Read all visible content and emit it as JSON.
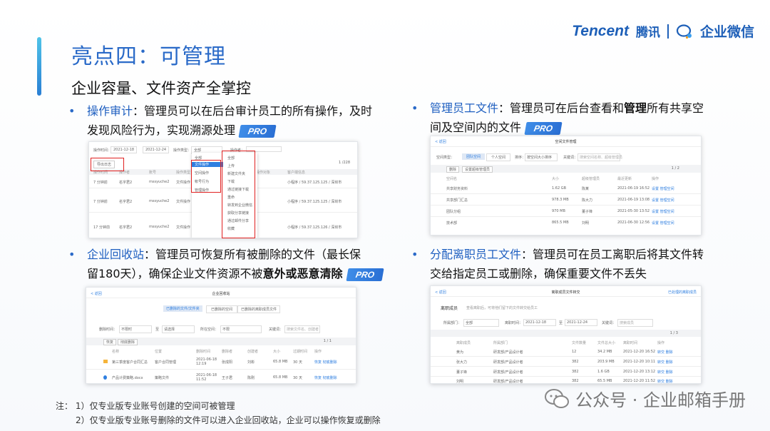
{
  "header": {
    "title": "亮点四：可管理",
    "subtitle": "企业容量、文件资产全掌控",
    "brand_tencent": "Tencent",
    "brand_tencent_cn": "腾讯",
    "brand_wecom": "企业微信"
  },
  "badge_label": "PRO",
  "sections": {
    "audit": {
      "head": "操作审计",
      "line1": "：管理员可以在后台审计员工的所有操作，及时",
      "line2": "发现风险行为，实现溯源处理"
    },
    "employee_files": {
      "head": "管理员工文件",
      "line1a": "：管理员可在后台查看和",
      "line1b": "管理",
      "line1c": "所有共享空",
      "line2": "间及空间内的文件"
    },
    "recycle": {
      "head": "企业回收站",
      "line1": "：管理员可恢复所有被删除的文件（最长保",
      "line2a": "留180天），确保企业文件资源不被",
      "line2b": "意外或恶意清除"
    },
    "transfer": {
      "head": "分配离职员工文件",
      "line1": "：管理员可在员工离职后将其文件转",
      "line2": "交给指定员工或删除，确保重要文件不丢失"
    }
  },
  "shot_audit": {
    "filter_label": "操作时间：",
    "date_from": "2021-12-18",
    "date_to": "2021-12-24",
    "type_label": "操作类型：",
    "type_value": "全部",
    "user_label": "操作者：",
    "export_button": "导出日志",
    "pager": "1 /228",
    "columns": [
      "操作时间",
      "操作者",
      "账号",
      "操作类型",
      "操作对象",
      "客户端信息"
    ],
    "rows": [
      {
        "time": "7 分钟前",
        "user": "名字君2",
        "account": "mssyuche2",
        "type": "文件操作",
        "client": "小程序 / 59.37.125.125 / 深圳市"
      },
      {
        "time": "7 分钟前",
        "user": "名字君2",
        "account": "mssyuche2",
        "type": "文件操作",
        "client": "小程序 / 59.37.125.125 / 深圳市"
      },
      {
        "time": "17 分钟前",
        "user": "名字君2",
        "account": "mssyuche2",
        "type": "文件操作",
        "client": "小程序 / 59.37.125.126 / 深圳市"
      }
    ],
    "dropdown_left": [
      "全部",
      "文件操作",
      "空间操作",
      "帐号行为",
      "管理操作"
    ],
    "dropdown_right": [
      "全部",
      "上传",
      "新建文件夹",
      "下载",
      "通过链接下载",
      "重命",
      "转发到企业微信",
      "获取分享链接",
      "通过邮件分享",
      "收藏"
    ]
  },
  "shot_space": {
    "title": "空间文件管理",
    "back": "< 返回",
    "type_label": "空间类型：",
    "tabs": [
      "团队空间",
      "个人空间"
    ],
    "sort_label": "排序：",
    "sort_value": "按空间大小排序",
    "search_label": "关键词：",
    "search_placeholder": "搜索空间名称、超级管理员",
    "btn_remove": "删除",
    "btn_members": "设置超级管理员",
    "pager": "1 / 2",
    "columns": [
      "空间名",
      "大小",
      "超级管理员",
      "最近更新",
      "操作"
    ],
    "rows": [
      {
        "name": "共享财务资料",
        "size": "1.62 GB",
        "admin": "陈某",
        "date": "2021-06-19 16:52",
        "ops": "设置  管理空间"
      },
      {
        "name": "共享部门汇总",
        "size": "978.3 MB",
        "admin": "陈大力",
        "date": "2021-06-19 13:08",
        "ops": "设置  管理空间"
      },
      {
        "name": "团队分组",
        "size": "970 MB",
        "admin": "董子锋",
        "date": "2021-05-30 13:52",
        "ops": "设置  管理空间"
      },
      {
        "name": "技术部",
        "size": "865.5 MB",
        "admin": "刘明",
        "date": "2021-06-30 12:56",
        "ops": "设置  管理空间"
      }
    ]
  },
  "shot_recycle": {
    "title": "企业回收站",
    "back": "< 返回",
    "tabs": [
      "已删除的文件/文件夹",
      "已删除的空间",
      "已删除的离职成员文件"
    ],
    "time_label": "删除时间：",
    "time_value": "不限时",
    "to": "至",
    "to_value": "请选择",
    "space_label": "所在空间：",
    "space_value": "不限",
    "kw_label": "关键词：",
    "kw_placeholder": "搜索文件名、创建者",
    "btn_restore": "恢复",
    "btn_delete": "彻底删除",
    "pager": "1 / 1",
    "columns": [
      "名称",
      "位置",
      "删除时间",
      "删除者",
      "创建者",
      "大小",
      "过期时间",
      "操作"
    ],
    "rows": [
      {
        "name": "第三季度客户合同汇总",
        "loc": "客户合同管理",
        "time": "2021-06-18 12:19",
        "by": "张成阳",
        "creator": "刘彬",
        "size": "65.8 MB",
        "exp": "30 天",
        "ops": "恢复  彻底删除"
      },
      {
        "name": "产品计费策略.docx",
        "loc": "策略文件",
        "time": "2021-06-18 11:52",
        "by": "王子君",
        "creator": "陈刚",
        "size": "65.8 MB",
        "exp": "30 天",
        "ops": "恢复  彻底删除"
      }
    ]
  },
  "shot_transfer": {
    "title": "离职成员文件转交",
    "back": "< 返回",
    "link": "已处理的离职成员",
    "section": "离职成员",
    "desc": "查看离职后，可将他们留下的文件转交给员工",
    "dept_label": "所属部门：",
    "dept_value": "全部",
    "time_label": "离职时间：",
    "date_from": "2021-12-18",
    "to": "至",
    "date_to": "2021-12-24",
    "kw_label": "关键词：",
    "kw_placeholder": "搜索成员",
    "pager": "1 / 3",
    "columns": [
      "离职成员",
      "所属部门",
      "文件数量",
      "文件总大小",
      "离职时间",
      "操作"
    ],
    "rows": [
      {
        "name": "黄为",
        "dept": "研发部/产品设计者",
        "count": "12",
        "size": "34.2 MB",
        "date": "2021-12-20 16:52",
        "ops": "转交  删除"
      },
      {
        "name": "张大力",
        "dept": "研发部/产品设计者",
        "count": "382",
        "size": "203.9 MB",
        "date": "2021-12-20 10:11",
        "ops": "转交  删除"
      },
      {
        "name": "董子锋",
        "dept": "研发部/产品设计者",
        "count": "382",
        "size": "1.6 GB",
        "date": "2021-12-20 13:12",
        "ops": "转交  删除"
      },
      {
        "name": "刘明",
        "dept": "研发部/产品设计者",
        "count": "382",
        "size": "65.5 MB",
        "date": "2021-12-20 11:52",
        "ops": "转交  删除"
      }
    ]
  },
  "notes": {
    "prefix": "注：",
    "line1": "1）仅专业版专业账号创建的空间可被管理",
    "line2": "2）仅专业版专业账号删除的文件可以进入企业回收站，企业可以操作恢复或删除"
  },
  "watermark": "公众号 · 企业邮箱手册"
}
